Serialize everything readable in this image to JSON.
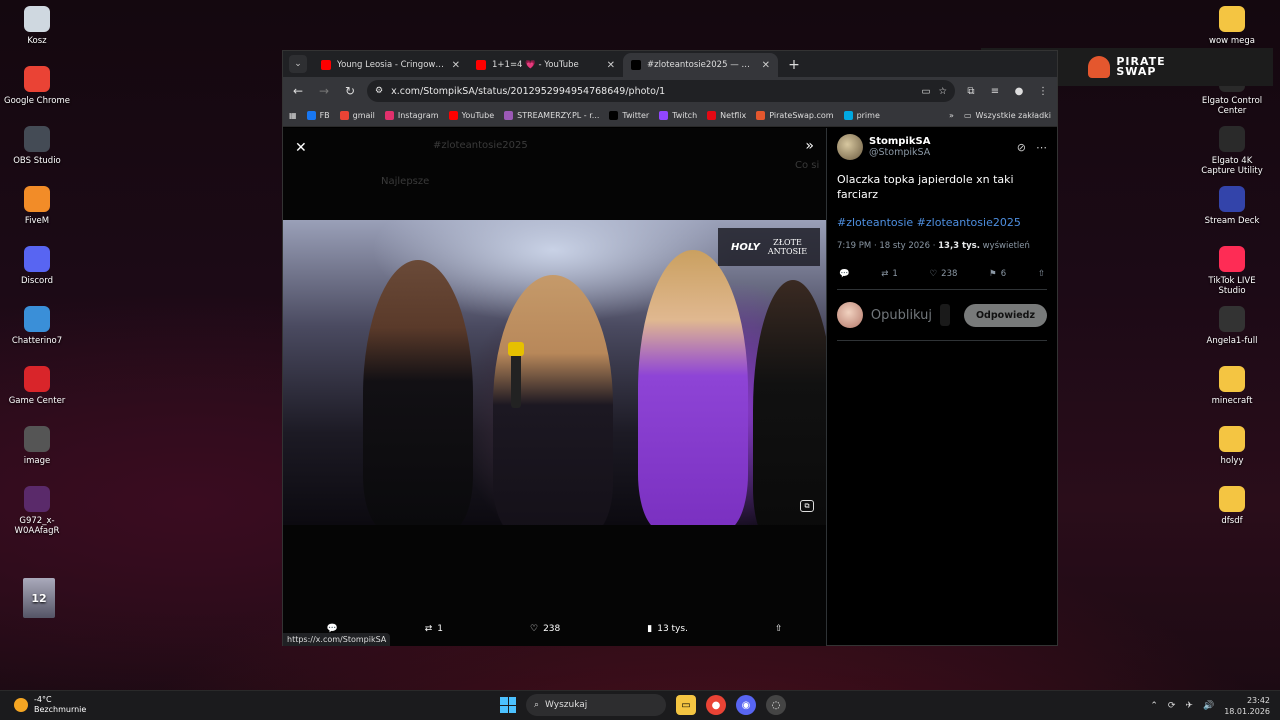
{
  "desktop": {
    "left_icons": [
      {
        "label": "Kosz",
        "icon": "recycle-bin-icon",
        "color": "#cfd8e0"
      },
      {
        "label": "Google Chrome",
        "icon": "chrome-icon",
        "color": "#ea4335"
      },
      {
        "label": "OBS Studio",
        "icon": "obs-icon",
        "color": "#444b55"
      },
      {
        "label": "FiveM",
        "icon": "fivem-icon",
        "color": "#f28c28"
      },
      {
        "label": "Discord",
        "icon": "discord-icon",
        "color": "#5865f2"
      },
      {
        "label": "Chatterino7",
        "icon": "chatterino-icon",
        "color": "#3a8fd8"
      },
      {
        "label": "Game Center",
        "icon": "game-center-icon",
        "color": "#d9252a"
      },
      {
        "label": "image",
        "icon": "image-file-icon",
        "color": "#555555"
      },
      {
        "label": "G972_x-W0AAfagR",
        "icon": "image-file-icon",
        "color": "#5a2a6a"
      }
    ],
    "right_icons": [
      {
        "label": "wow mega",
        "icon": "folder-icon",
        "color": "#f4c542"
      },
      {
        "label": "Elgato Control Center",
        "icon": "elgato-icon",
        "color": "#2a2a2a"
      },
      {
        "label": "Elgato 4K Capture Utility",
        "icon": "elgato-4k-icon",
        "color": "#2a2a2a"
      },
      {
        "label": "Stream Deck",
        "icon": "stream-deck-icon",
        "color": "#3344aa"
      },
      {
        "label": "TikTok LIVE Studio",
        "icon": "tiktok-icon",
        "color": "#fe2c55"
      },
      {
        "label": "Angela1-full",
        "icon": "image-file-icon",
        "color": "#333333"
      },
      {
        "label": "minecraft",
        "icon": "folder-icon",
        "color": "#f4c542"
      },
      {
        "label": "holyy",
        "icon": "folder-icon",
        "color": "#f4c542"
      },
      {
        "label": "dfsdf",
        "icon": "folder-icon",
        "color": "#f4c542"
      }
    ],
    "thumb_label": "12"
  },
  "overlay": {
    "brand_line1": "PIRATE",
    "brand_line2": "SWAP"
  },
  "browser": {
    "tabs": [
      {
        "title": "Young Leosia - Cringowy Lovesong",
        "fav_color": "#ff0000",
        "active": false
      },
      {
        "title": "1+1=4 💗 - YouTube",
        "fav_color": "#ff0000",
        "active": false
      },
      {
        "title": "#zloteantosie2025 — Wyszukiwanie",
        "fav_color": "#000000",
        "active": true
      }
    ],
    "url": "x.com/StompikSA/status/2012952994954768649/photo/1",
    "bookmarks": [
      {
        "label": "FB",
        "color": "#1877f2"
      },
      {
        "label": "gmail",
        "color": "#ea4335"
      },
      {
        "label": "Instagram",
        "color": "#e1306c"
      },
      {
        "label": "YouTube",
        "color": "#ff0000"
      },
      {
        "label": "STREAMERZY.PL - r...",
        "color": "#9b59b6"
      },
      {
        "label": "Twitter",
        "color": "#000000"
      },
      {
        "label": "Twitch",
        "color": "#9146ff"
      },
      {
        "label": "Netflix",
        "color": "#e50914"
      },
      {
        "label": "PirateSwap.com",
        "color": "#e4572e"
      },
      {
        "label": "prime",
        "color": "#00a8e1"
      }
    ],
    "bookmarks_folder": "Wszystkie zakładki",
    "status_url": "https://x.com/StompikSA"
  },
  "media": {
    "ghost_texts": [
      "#zloteantosie2025",
      "Najlepsze",
      "Co si"
    ],
    "overlay_logo": "HOLY",
    "overlay_title_1": "ZŁOTE",
    "overlay_title_2": "ANTOSIE",
    "bar": {
      "retweets": "1",
      "likes": "238",
      "views": "13 tys."
    }
  },
  "tweet": {
    "display_name": "StompikSA",
    "handle": "@StompikSA",
    "text": "Olaczka topka japierdole xn taki farciarz",
    "hashtags": "#zloteantosie #zloteantosie2025",
    "time": "7:19 PM · 18 sty 2026 · ",
    "views_count": "13,3 tys.",
    "views_label": " wyświetleń",
    "retweets": "1",
    "likes": "238",
    "bookmarks": "6",
    "reply_placeholder": "Opublikuj",
    "reply_button": "Odpowiedz"
  },
  "taskbar": {
    "temp": "-4°C",
    "condition": "Bezchmurnie",
    "search": "Wyszukaj",
    "time": "23:42",
    "date": "18.01.2026"
  }
}
